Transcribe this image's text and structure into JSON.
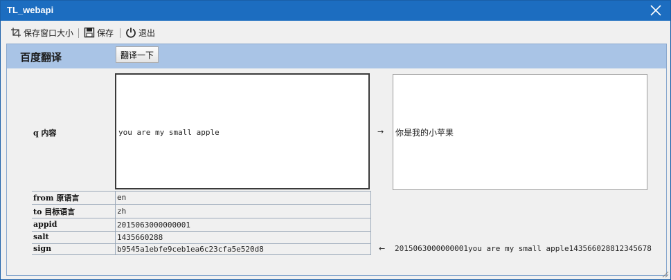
{
  "window": {
    "title": "TL_webapi"
  },
  "toolbar": {
    "save_size_label": "保存窗口大小",
    "save_label": "保存",
    "exit_label": "退出"
  },
  "panel": {
    "title": "百度翻译",
    "translate_button": "翻译一下"
  },
  "form": {
    "q_label": "q 内容",
    "q_value": "you are my small apple",
    "result_arrow": "→",
    "result_value": "你是我的小苹果",
    "from_label": "from 原语言",
    "from_value": "en",
    "to_label": "to 目标语言",
    "to_value": "zh",
    "appid_label": "appid",
    "appid_value": "2015063000000001",
    "salt_label": "salt",
    "salt_value": "1435660288",
    "sign_label": "sign",
    "sign_value": "b9545a1ebfe9ceb1ea6c23cfa5e520d8",
    "sign_arrow": "←",
    "sign_source": "2015063000000001you are my small apple143566028812345678"
  }
}
